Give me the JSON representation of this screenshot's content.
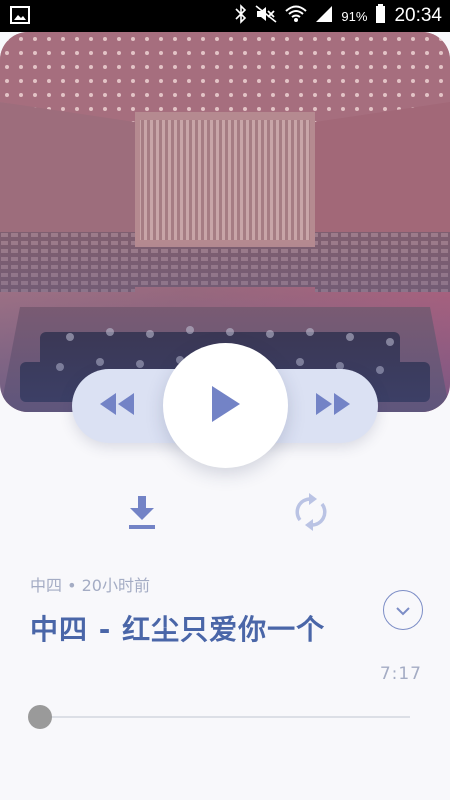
{
  "status_bar": {
    "battery_pct": "91%",
    "time": "20:34",
    "icons": [
      "image-icon",
      "bluetooth-icon",
      "mute-icon",
      "wifi-icon",
      "signal-icon",
      "battery-icon"
    ]
  },
  "hero": {
    "image": "concert-hall-orchestra"
  },
  "controls": {
    "rewind_icon": "rewind-icon",
    "play_icon": "play-icon",
    "forward_icon": "fast-forward-icon"
  },
  "actions": {
    "download_icon": "download-icon",
    "repeat_icon": "repeat-icon"
  },
  "track": {
    "meta": "中四 • 20小时前",
    "title": "中四 - 红尘只爱你一个",
    "duration": "7:17",
    "progress": 0
  },
  "colors": {
    "accent": "#4a66a8",
    "icon": "#7383c6",
    "pill": "#dbe1f3",
    "muted": "#a4acc4"
  }
}
